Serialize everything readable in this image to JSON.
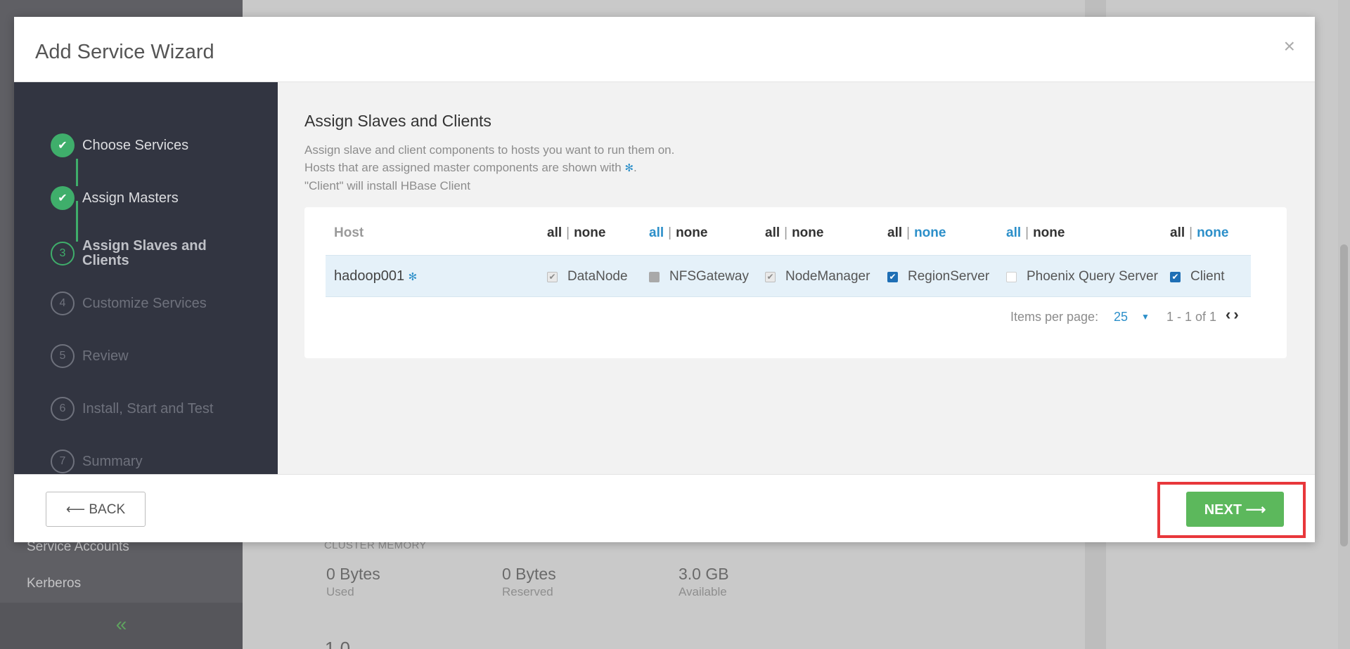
{
  "background": {
    "sidebar_links": [
      "Service Accounts",
      "Kerberos"
    ],
    "collapse_icon": "«",
    "cluster_memory_title": "CLUSTER MEMORY",
    "stats": [
      {
        "value": "0 Bytes",
        "label": "Used"
      },
      {
        "value": "0 Bytes",
        "label": "Reserved"
      },
      {
        "value": "3.0 GB",
        "label": "Available"
      }
    ],
    "bottom_number": "1.0"
  },
  "modal": {
    "title": "Add Service Wizard",
    "close": "×",
    "steps": [
      {
        "label": "Choose Services",
        "state": "done",
        "marker": "✔"
      },
      {
        "label": "Assign Masters",
        "state": "done",
        "marker": "✔"
      },
      {
        "label": "Assign Slaves and Clients",
        "state": "current",
        "marker": "3"
      },
      {
        "label": "Customize Services",
        "state": "todo",
        "marker": "4"
      },
      {
        "label": "Review",
        "state": "todo",
        "marker": "5"
      },
      {
        "label": "Install, Start and Test",
        "state": "todo",
        "marker": "6"
      },
      {
        "label": "Summary",
        "state": "todo",
        "marker": "7"
      }
    ],
    "content": {
      "heading": "Assign Slaves and Clients",
      "desc_line1": "Assign slave and client components to hosts you want to run them on.",
      "desc_line2": "Hosts that are assigned master components are shown with",
      "desc_line2_end": ".",
      "desc_line3": "\"Client\" will install HBase Client",
      "star": "✻"
    },
    "table": {
      "host_header": "Host",
      "all_label": "all",
      "none_label": "none",
      "sep": "|",
      "host": "hadoop001",
      "components": [
        {
          "name": "DataNode",
          "state": "checked-disabled",
          "all_active": false,
          "none_active": false
        },
        {
          "name": "NFSGateway",
          "state": "filled-disabled",
          "all_active": true,
          "none_active": false
        },
        {
          "name": "NodeManager",
          "state": "checked-disabled",
          "all_active": false,
          "none_active": false
        },
        {
          "name": "RegionServer",
          "state": "checked",
          "all_active": false,
          "none_active": true
        },
        {
          "name": "Phoenix Query Server",
          "state": "unchecked",
          "all_active": true,
          "none_active": false
        },
        {
          "name": "Client",
          "state": "checked",
          "all_active": false,
          "none_active": true
        }
      ],
      "items_per_page_label": "Items per page:",
      "items_per_page_value": "25",
      "dropdown_arrow": "▼",
      "range": "1 - 1 of 1",
      "prev": "‹",
      "next": "›"
    },
    "footer": {
      "back_label": "⟵ BACK",
      "next_label": "NEXT ⟶"
    }
  },
  "colors": {
    "accent_green": "#5cb85c",
    "link_blue": "#2c8fc9",
    "sidebar_dark": "#323541",
    "highlight_red": "#e8373b"
  }
}
